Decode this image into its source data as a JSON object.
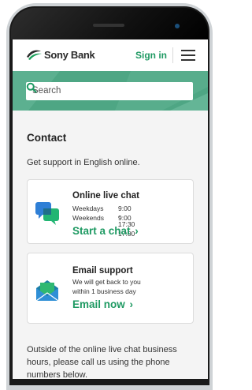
{
  "header": {
    "brand": "Sony Bank",
    "signin_label": "Sign in"
  },
  "search": {
    "placeholder": "Search"
  },
  "page": {
    "title": "Contact",
    "lead": "Get support in English online."
  },
  "chat_card": {
    "title": "Online live chat",
    "rows": [
      {
        "label": "Weekdays",
        "time": "9:00 - 17:30"
      },
      {
        "label": "Weekends",
        "time": "9:00 - 17:00"
      }
    ],
    "cta": "Start a chat",
    "cta_chevron": "›"
  },
  "email_card": {
    "title": "Email support",
    "line1": "We will get back to you",
    "line2": "within 1 business day",
    "cta": "Email now",
    "cta_chevron": "›"
  },
  "note": "Outside of the online live chat business hours, please call us using the phone numbers below.",
  "colors": {
    "accent": "#1f9a63",
    "band": "#4ea684",
    "chat_blue": "#2f7fd6",
    "chat_green": "#22b573"
  }
}
